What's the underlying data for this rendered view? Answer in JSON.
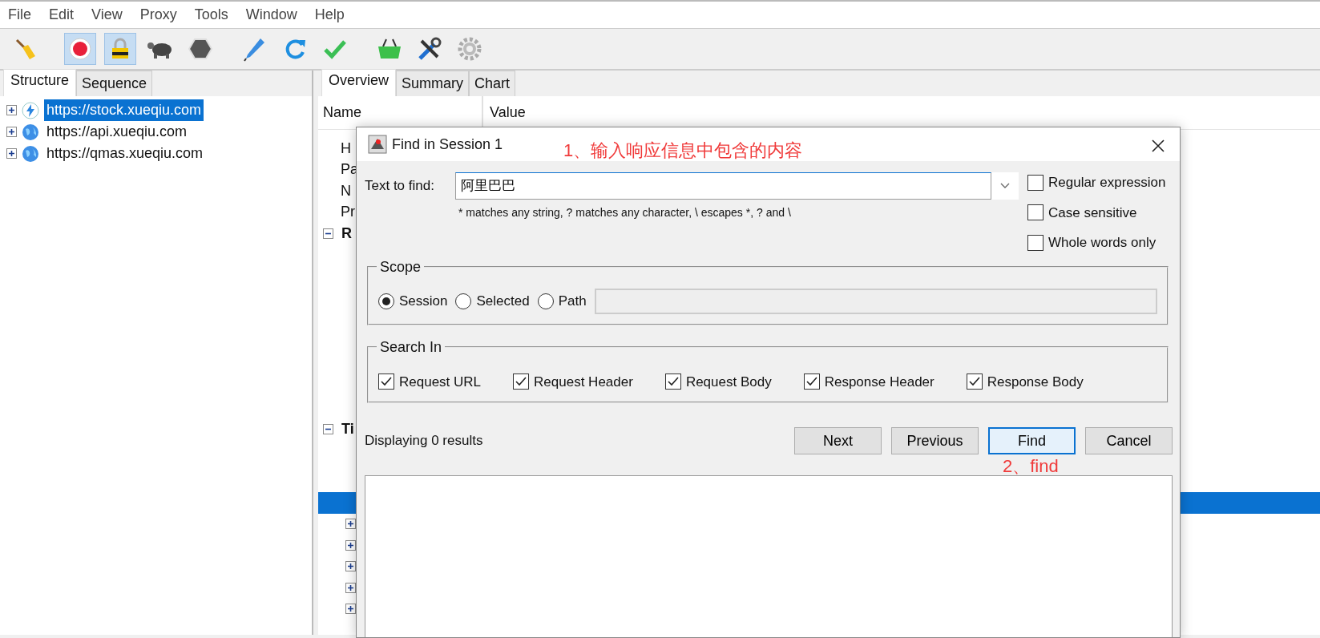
{
  "menu": [
    "File",
    "Edit",
    "View",
    "Proxy",
    "Tools",
    "Window",
    "Help"
  ],
  "toolbar": [
    {
      "kind": "broom",
      "pressed": false
    },
    {
      "kind": "record",
      "pressed": true
    },
    {
      "kind": "lock",
      "pressed": true
    },
    {
      "kind": "turtle",
      "pressed": false
    },
    {
      "kind": "stop",
      "pressed": false
    },
    {
      "kind": "pen",
      "pressed": false
    },
    {
      "kind": "refresh",
      "pressed": false
    },
    {
      "kind": "check",
      "pressed": false
    },
    {
      "kind": "basket",
      "pressed": false
    },
    {
      "kind": "tools",
      "pressed": false
    },
    {
      "kind": "gear",
      "pressed": false
    }
  ],
  "left_tabs": [
    {
      "label": "Structure",
      "selected": true
    },
    {
      "label": "Sequence",
      "selected": false
    }
  ],
  "hosts": [
    {
      "label": "https://stock.xueqiu.com",
      "kind": "bolt",
      "selected": true
    },
    {
      "label": "https://api.xueqiu.com",
      "kind": "globe",
      "selected": false
    },
    {
      "label": "https://qmas.xueqiu.com",
      "kind": "globe",
      "selected": false
    }
  ],
  "right_tabs": [
    {
      "label": "Overview",
      "selected": true
    },
    {
      "label": "Summary",
      "selected": false
    },
    {
      "label": "Chart",
      "selected": false
    }
  ],
  "table": {
    "columns": [
      "Name",
      "Value"
    ],
    "rows": [
      {
        "kind": "field",
        "label": "H"
      },
      {
        "kind": "field",
        "label": "Pa"
      },
      {
        "kind": "field",
        "label": "N"
      },
      {
        "kind": "field",
        "label": "Pr"
      },
      {
        "kind": "section",
        "label": "R",
        "expanded": true
      },
      {
        "kind": "section",
        "label": "Ti",
        "expanded": true
      },
      {
        "kind": "blank",
        "selected": true
      },
      {
        "kind": "node",
        "expanded": false
      },
      {
        "kind": "node",
        "expanded": false
      },
      {
        "kind": "node",
        "expanded": false
      },
      {
        "kind": "node",
        "expanded": false
      },
      {
        "kind": "node",
        "expanded": false
      }
    ]
  },
  "dialog": {
    "title": "Find in Session 1",
    "find_label": "Text to find:",
    "find_value": "阿里巴巴",
    "hint": "* matches any string, ? matches any character, \\ escapes *, ? and \\",
    "options": [
      {
        "label": "Regular expression",
        "checked": false
      },
      {
        "label": "Case sensitive",
        "checked": false
      },
      {
        "label": "Whole words only",
        "checked": false
      }
    ],
    "scope": {
      "legend": "Scope",
      "radios": [
        {
          "label": "Session",
          "selected": true
        },
        {
          "label": "Selected",
          "selected": false
        },
        {
          "label": "Path",
          "selected": false
        }
      ]
    },
    "search_in": {
      "legend": "Search In",
      "checks": [
        {
          "label": "Request URL",
          "checked": true
        },
        {
          "label": "Request Header",
          "checked": true
        },
        {
          "label": "Request Body",
          "checked": true
        },
        {
          "label": "Response Header",
          "checked": true
        },
        {
          "label": "Response Body",
          "checked": true
        }
      ]
    },
    "status": "Displaying 0 results",
    "buttons": [
      {
        "label": "Next",
        "focused": false
      },
      {
        "label": "Previous",
        "focused": false
      },
      {
        "label": "Find",
        "focused": true
      },
      {
        "label": "Cancel",
        "focused": false
      }
    ]
  },
  "annotations": [
    {
      "text": "1、输入响应信息中包含的内容"
    },
    {
      "text": "2、find"
    }
  ]
}
